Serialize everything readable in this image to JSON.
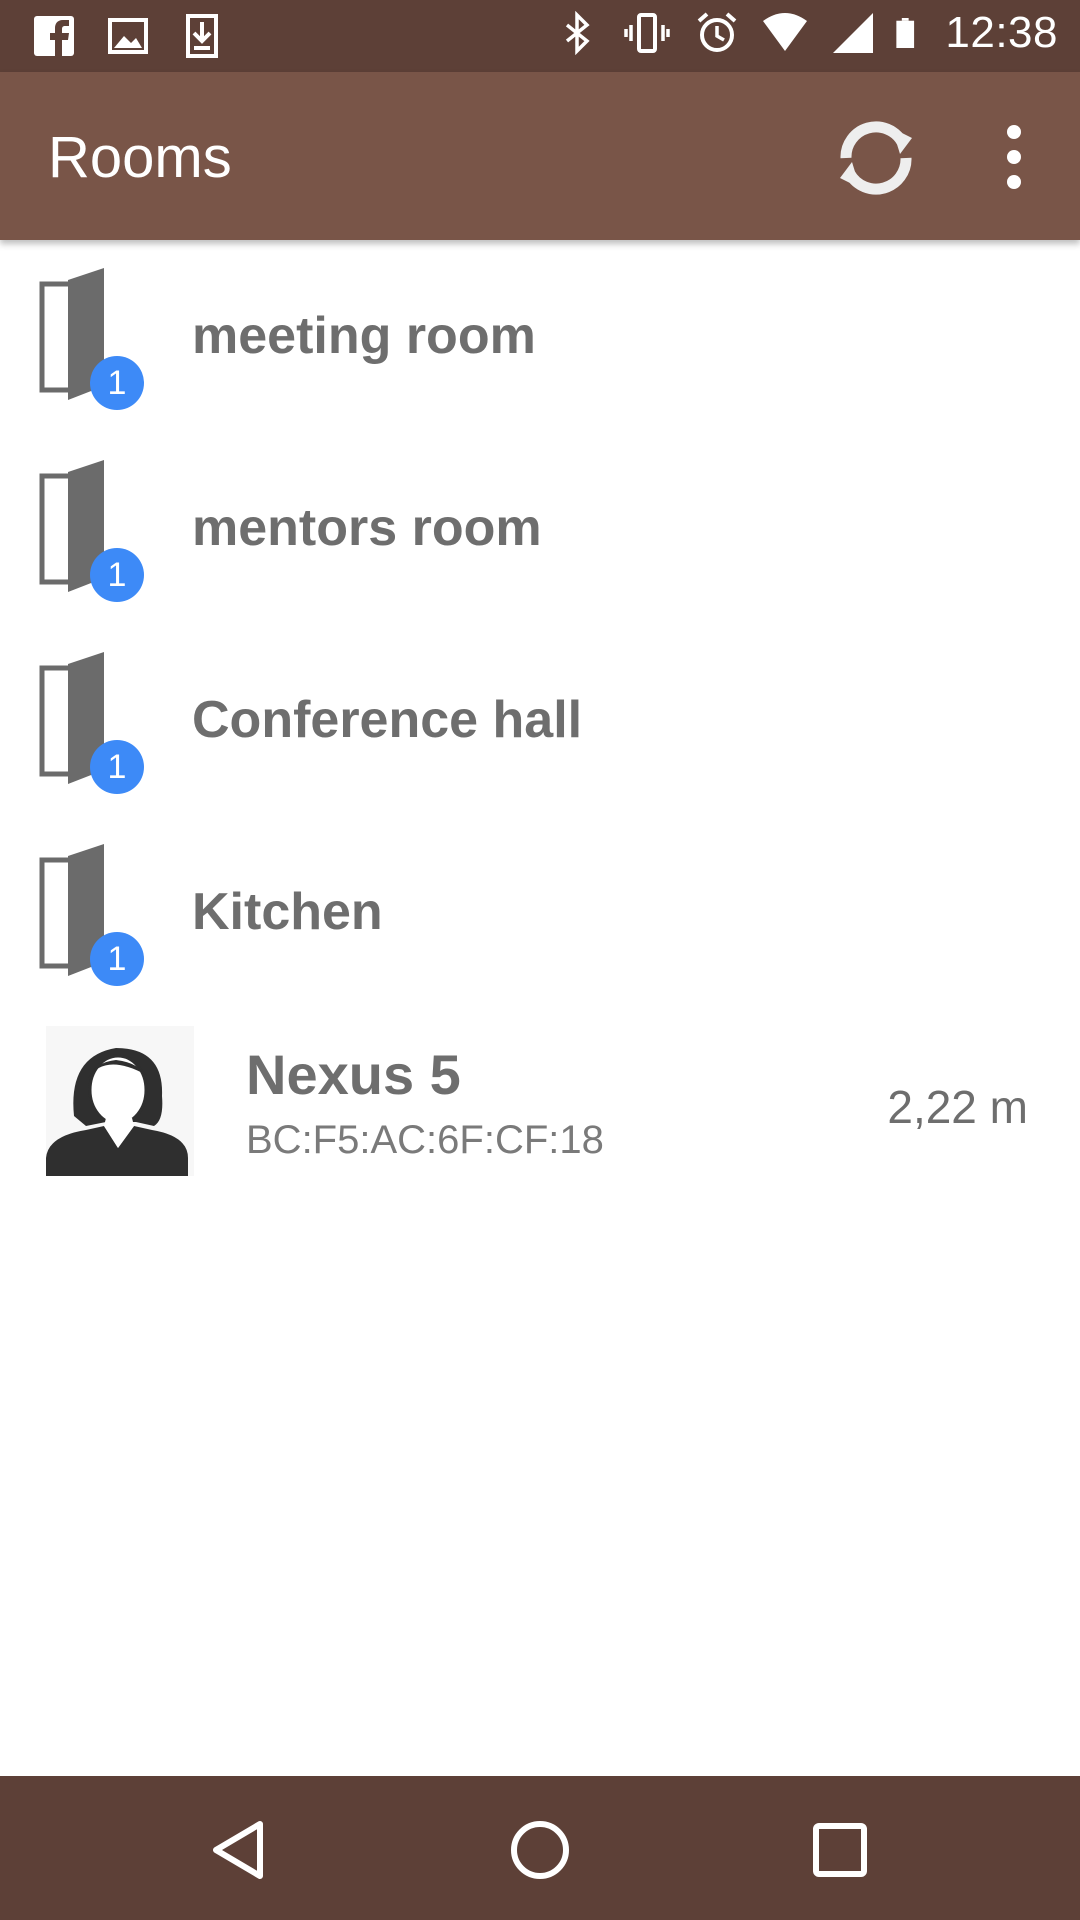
{
  "status_bar": {
    "time": "12:38",
    "left_icons": [
      "facebook-icon",
      "image-icon",
      "download-icon"
    ],
    "right_icons": [
      "bluetooth-icon",
      "vibrate-icon",
      "alarm-icon",
      "wifi-icon",
      "signal-icon",
      "battery-icon"
    ]
  },
  "app_bar": {
    "title": "Rooms",
    "actions": [
      "refresh-icon",
      "overflow-menu-icon"
    ],
    "background": "#795548"
  },
  "rooms": [
    {
      "name": "meeting room",
      "badge": "1"
    },
    {
      "name": "mentors room",
      "badge": "1"
    },
    {
      "name": "Conference hall",
      "badge": "1"
    },
    {
      "name": "Kitchen",
      "badge": "1"
    }
  ],
  "device": {
    "name": "Nexus 5",
    "mac": "BC:F5:AC:6F:CF:18",
    "distance": "2,22 m"
  },
  "nav_bar": {
    "buttons": [
      "back-icon",
      "home-icon",
      "recents-icon"
    ]
  },
  "colors": {
    "status_bar": "#5d4037",
    "badge": "#3d8af7",
    "text_gray": "#6e6e6e"
  }
}
